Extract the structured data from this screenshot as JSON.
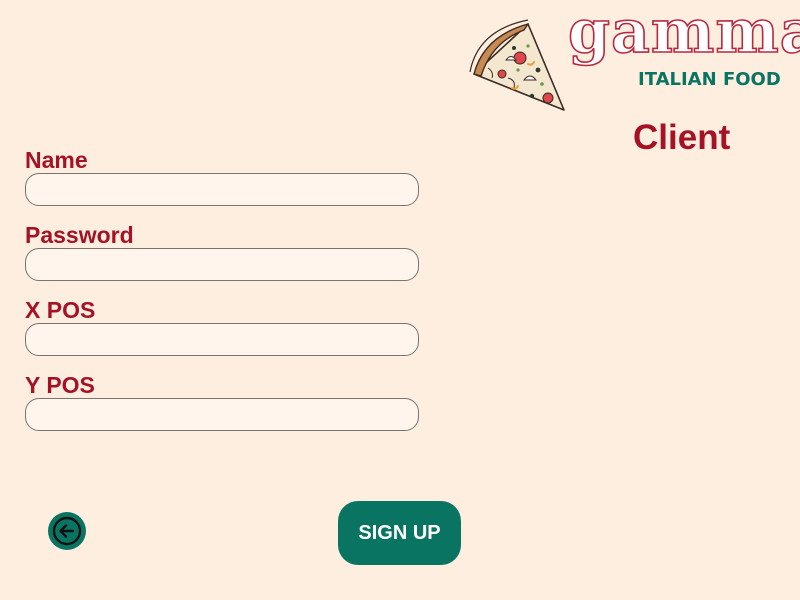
{
  "brand": {
    "name": "gamma",
    "subtitle": "ITALIAN FOOD",
    "logo_icon": "pizza-slice-icon",
    "colors": {
      "brand_red": "#b8283f",
      "brand_green": "#0a7463"
    }
  },
  "page": {
    "title": "Client",
    "background": "#feeedf"
  },
  "form": {
    "fields": [
      {
        "label": "Name",
        "value": "",
        "placeholder": ""
      },
      {
        "label": "Password",
        "value": "",
        "placeholder": ""
      },
      {
        "label": "X POS",
        "value": "",
        "placeholder": ""
      },
      {
        "label": "Y POS",
        "value": "",
        "placeholder": ""
      }
    ]
  },
  "actions": {
    "back_icon": "arrow-left-circle-icon",
    "signup_label": "SIGN UP"
  }
}
